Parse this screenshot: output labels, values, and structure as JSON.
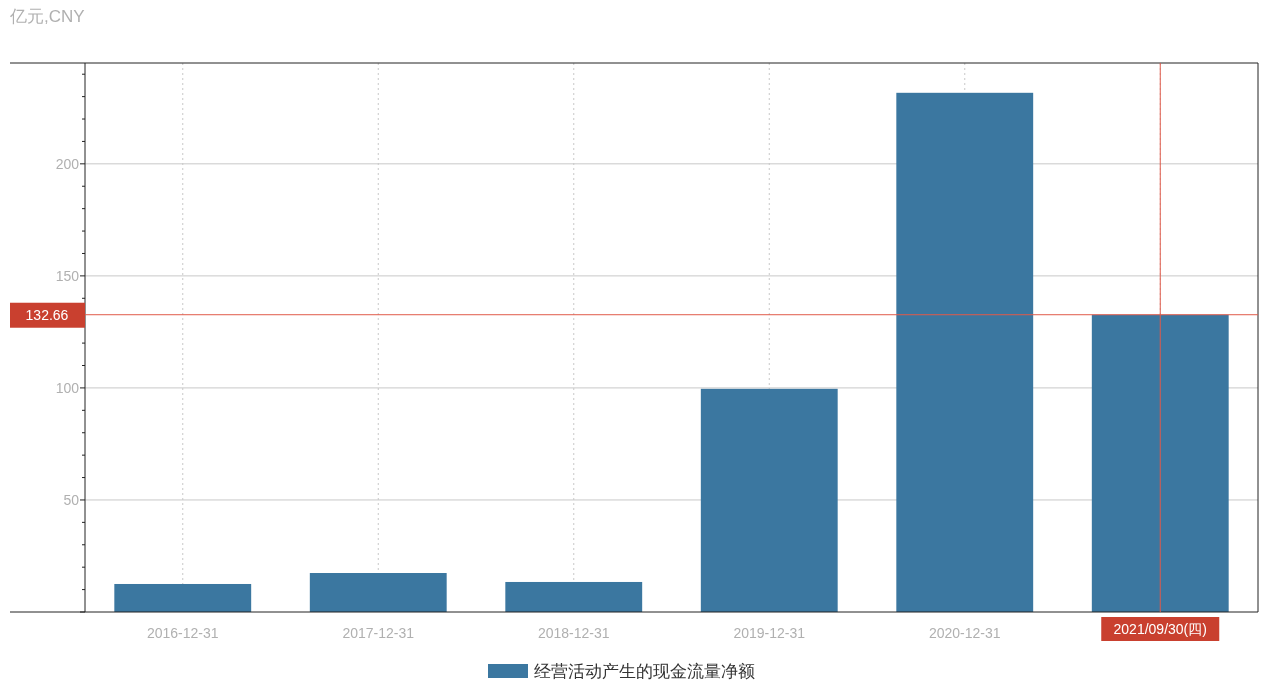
{
  "y_unit": "亿元,CNY",
  "chart_data": {
    "type": "bar",
    "categories": [
      "2016-12-31",
      "2017-12-31",
      "2018-12-31",
      "2019-12-31",
      "2020-12-31",
      "2021/09/30(四)"
    ],
    "series": [
      {
        "name": "经营活动产生的现金流量净额",
        "color": "#3b77a0",
        "values": [
          12.5,
          17.4,
          13.4,
          99.6,
          231.7,
          132.66
        ]
      }
    ],
    "ylim": [
      0,
      245
    ],
    "yticks": [
      50,
      100,
      150,
      200
    ],
    "grid": true,
    "ref_lines": [
      {
        "axis": "y",
        "value": 132.66,
        "label": "132.66",
        "color": "#e05a4a"
      },
      {
        "axis": "x",
        "value": "2021/09/30(四)",
        "color": "#e05a4a"
      }
    ]
  }
}
